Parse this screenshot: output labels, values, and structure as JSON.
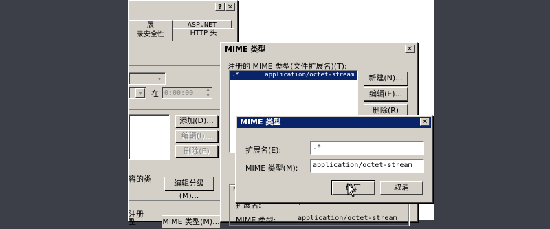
{
  "background_window": {
    "title_buttons": [
      "?",
      "✕"
    ],
    "tabs": [
      "展",
      "ASP.NET",
      "录安全性",
      "HTTP 头"
    ],
    "time_label": "在",
    "time_value": "0:00:00",
    "buttons": {
      "add": "添加(D)...",
      "edit": "编辑(I)...",
      "delete": "删除(E)"
    },
    "content_rating_text": "容的类",
    "edit_rating_button": "编辑分级(M)...",
    "mime_group_text_1": "注册",
    "mime_group_text_2": "型",
    "mime_types_button": "MIME 类型(M)..."
  },
  "mime_list_dialog": {
    "title": "MIME 类型",
    "close": "✕",
    "registered_label": "注册的 MIME 类型(文件扩展名)(T):",
    "list_items": [
      {
        "ext": ".*",
        "type": "application/octet-stream",
        "selected": true
      }
    ],
    "buttons": {
      "new": "新建(N)...",
      "edit": "编辑(E)...",
      "delete": "删除(R)"
    },
    "details_ext_label": "扩展名:",
    "details_ext_value": ".*",
    "details_mime_label": "MIME 类型:",
    "details_mime_value": "application/octet-stream",
    "group_marker": "M"
  },
  "mime_edit_dialog": {
    "title": "MIME 类型",
    "close": "✕",
    "ext_label": "扩展名(E):",
    "ext_value": ".*",
    "mime_label": "MIME 类型(M):",
    "mime_value": "application/octet-stream",
    "ok": "确定",
    "cancel": "取消"
  },
  "colors": {
    "titlebar": "#0a246a",
    "face": "#d4d0c8",
    "desktop": "#3c3f47"
  }
}
